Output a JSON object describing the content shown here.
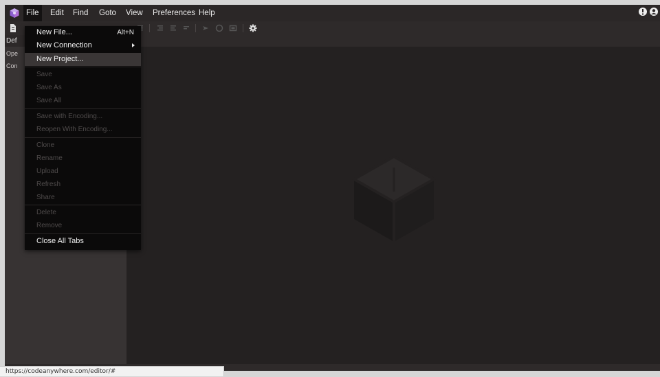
{
  "menubar": {
    "items": [
      {
        "label": "File",
        "active": true
      },
      {
        "label": "Edit"
      },
      {
        "label": "Find"
      },
      {
        "label": "Goto"
      },
      {
        "label": "View"
      },
      {
        "label": "Preferences"
      },
      {
        "label": "Help"
      }
    ],
    "right_icons": [
      "notification-icon",
      "user-account-icon"
    ]
  },
  "toolbar": {
    "icons": [
      "new-file-icon",
      "list-icon",
      "indent-icon",
      "outdent-icon",
      "format-icon",
      "run-icon",
      "stop-icon",
      "preview-icon",
      "settings-gear-icon"
    ]
  },
  "sidebar": {
    "header": "Def",
    "rows": [
      "Ope",
      "Con"
    ]
  },
  "file_menu": {
    "items": [
      {
        "label": "New File...",
        "shortcut": "Alt+N",
        "enabled": true
      },
      {
        "label": "New Connection",
        "submenu": true,
        "enabled": true
      },
      {
        "label": "New Project...",
        "enabled": true,
        "hover": true
      },
      {
        "label": "Save",
        "enabled": false
      },
      {
        "label": "Save As",
        "enabled": false
      },
      {
        "label": "Save All",
        "enabled": false
      },
      {
        "label": "Save with Encoding...",
        "enabled": false
      },
      {
        "label": "Reopen With Encoding...",
        "enabled": false
      },
      {
        "label": "Clone",
        "enabled": false
      },
      {
        "label": "Rename",
        "enabled": false
      },
      {
        "label": "Upload",
        "enabled": false
      },
      {
        "label": "Refresh",
        "enabled": false
      },
      {
        "label": "Share",
        "enabled": false
      },
      {
        "label": "Delete",
        "enabled": false
      },
      {
        "label": "Remove",
        "enabled": false
      },
      {
        "label": "Close All Tabs",
        "enabled": true
      }
    ]
  },
  "status_bar": {
    "url": "https://codeanywhere.com/editor/#"
  },
  "colors": {
    "background": "#242121",
    "menubar": "#2b2727",
    "sidebar": "#373333",
    "dropdown": "#0b0a0a",
    "logo": "#9b7bd4"
  }
}
